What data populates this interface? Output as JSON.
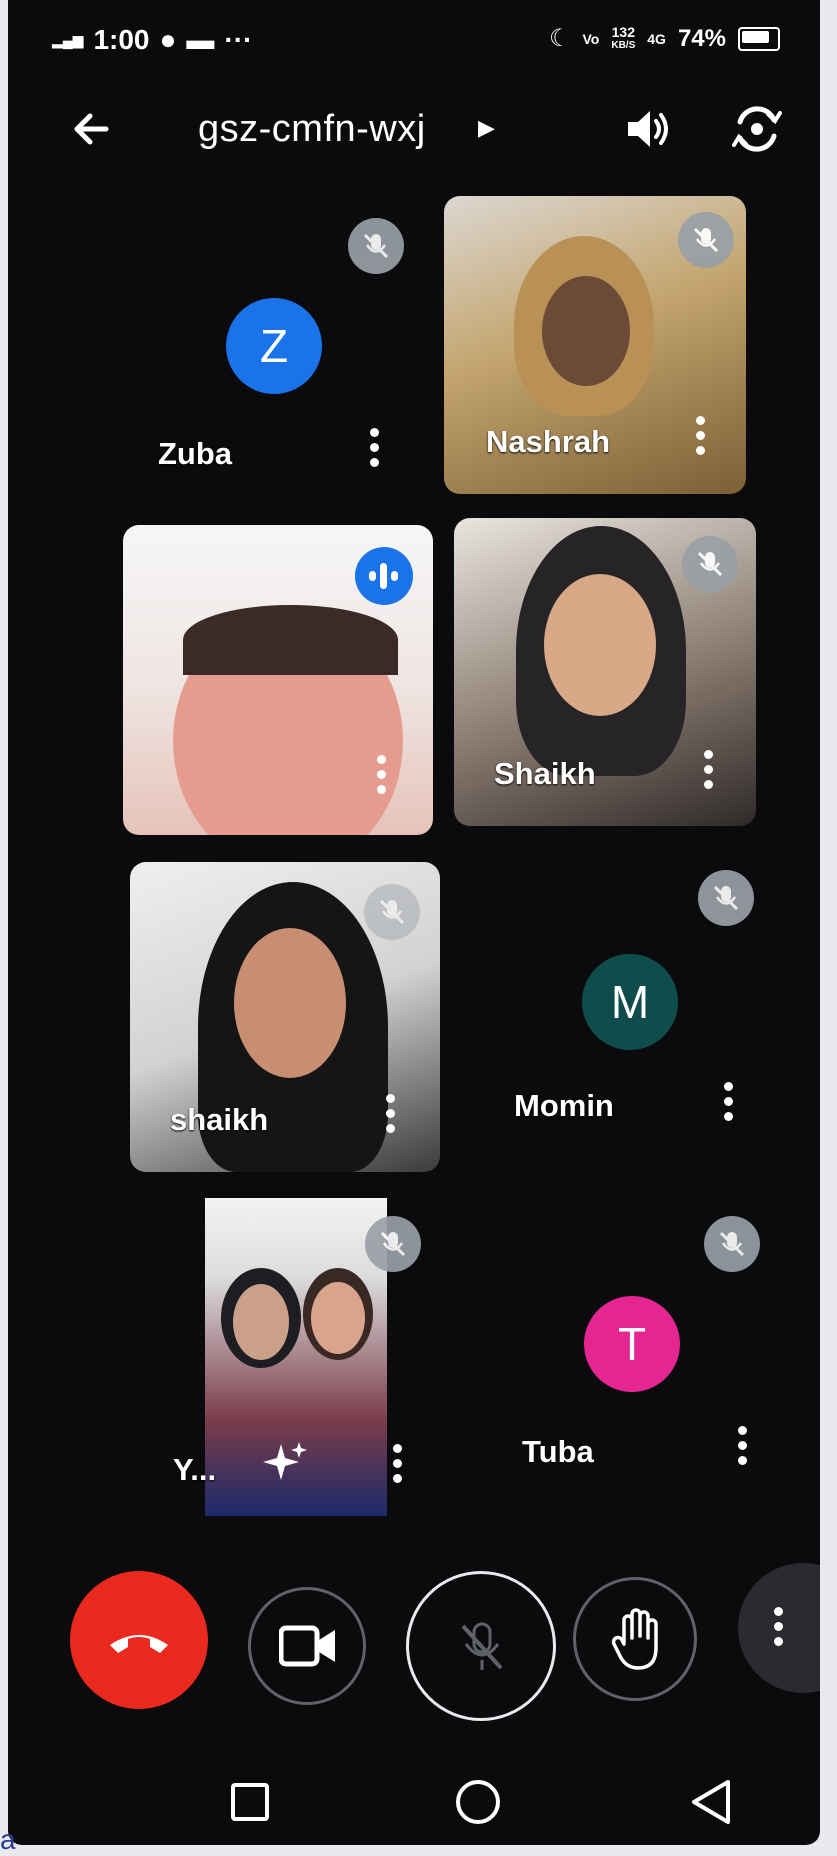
{
  "status": {
    "time": "1:00",
    "battery": "74%",
    "net_speed_top": "132",
    "net_speed_bottom": "KB/S",
    "signal_tag": "4G"
  },
  "meeting": {
    "code": "gsz-cmfn-wxj"
  },
  "participants": [
    {
      "name": "Zuba",
      "initial": "Z",
      "avatar_color": "#1a73e8",
      "muted": true,
      "video": false
    },
    {
      "name": "Nashrah",
      "muted": true,
      "video": true
    },
    {
      "name": "",
      "muted": false,
      "speaking": true,
      "video": true
    },
    {
      "name": "Shaikh",
      "muted": true,
      "video": true
    },
    {
      "name": "shaikh",
      "muted": true,
      "video": true
    },
    {
      "name": "Momin",
      "initial": "M",
      "avatar_color": "#0f4c4c",
      "muted": true,
      "video": false
    },
    {
      "name": "Y...",
      "muted": true,
      "video": true
    },
    {
      "name": "Tuba",
      "initial": "T",
      "avatar_color": "#e52592",
      "muted": true,
      "video": false
    }
  ],
  "colors": {
    "end_call": "#ea2a1f",
    "accent": "#1a73e8",
    "background": "#0b0b0d"
  },
  "icons": {
    "controls": [
      "end-call-icon",
      "video-camera-icon",
      "mic-off-icon",
      "raise-hand-icon",
      "more-vert-icon"
    ],
    "nav": [
      "recents-square-icon",
      "home-circle-icon",
      "back-triangle-icon"
    ]
  },
  "decor_letter": "a"
}
